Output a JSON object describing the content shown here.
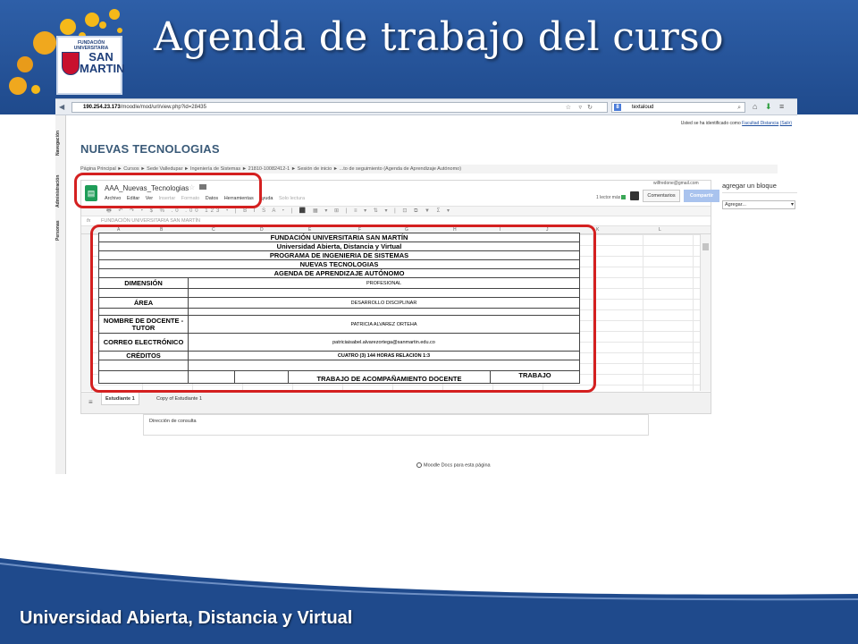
{
  "slide": {
    "title": "Agenda de trabajo del curso",
    "footer": "Universidad Abierta, Distancia y Virtual",
    "logo": {
      "top": "FUNDACIÓN UNIVERSITARIA",
      "name_1": "SAN",
      "name_2": "MARTIN"
    }
  },
  "browser": {
    "url_host": "190.254.23.173",
    "url_path": "/moodle/mod/url/view.php?id=28435",
    "search_value": "textaloud",
    "search_engine_icon": "google-icon"
  },
  "moodle": {
    "sidebar": [
      "Navegación",
      "Administración",
      "Personas"
    ],
    "login_prefix": "Usted se ha identificado como",
    "login_user": "Facultad Distancia",
    "login_logout": "(Salir)",
    "course_title": "NUEVAS TECNOLOGIAS",
    "breadcrumb": "Página Principal ► Cursos ► Sede Valledupar ► Ingeniería de Sistemas ► 21810-10082412-1 ► Sesión de inicio ► ...to de seguimiento (Agenda de Aprendizaje Autónomo)",
    "consulta": "Dirección de consulta",
    "moodle_docs": "Moodle Docs para esta página",
    "block_title": "agregar un bloque",
    "block_select": "Agregar..."
  },
  "sheet": {
    "doc_name": "AAA_Nuevas_Tecnologias",
    "menu": [
      "Archivo",
      "Editar",
      "Ver",
      "Insertar",
      "Formato",
      "Datos",
      "Herramientas",
      "Ayuda",
      "Solo lectura"
    ],
    "menu_disabled": [
      false,
      false,
      false,
      true,
      true,
      false,
      false,
      false,
      true
    ],
    "email": "wilfredone@gmail.com",
    "readers": "1 lector más",
    "comments_button": "Comentarios",
    "share_button": "Compartir",
    "fx_label": "fx",
    "fx_value": "FUNDACIÓN UNIVERSITARIA SAN MARTÍN",
    "columns": [
      "A",
      "B",
      "C",
      "D",
      "E",
      "F",
      "G",
      "H",
      "I",
      "J",
      "K",
      "L"
    ],
    "tabs": [
      "Estudiante 1",
      "Copy of Estudiante 1"
    ]
  },
  "agenda": {
    "headers": [
      "FUNDACIÓN UNIVERSITARIA SAN MARTÍN",
      "Universidad Abierta, Distancia y Virtual",
      "PROGRAMA DE INGENIERIA DE SISTEMAS",
      "NUEVAS TECNOLOGIAS",
      "AGENDA DE APRENDIZAJE AUTÓNOMO"
    ],
    "rows": [
      {
        "label": "DIMENSIÓN",
        "value": "PROFESIONAL"
      },
      {
        "label": "ÁREA",
        "value": "DESARROLLO DISCIPLINAR"
      },
      {
        "label": "NOMBRE DE DOCENTE - TUTOR",
        "value": "PATRICIA ALVAREZ ORTEHA"
      },
      {
        "label": "CORREO ELECTRÓNICO",
        "value": "patriciaisabel.alvarezortega@sanmartin.edu.co"
      },
      {
        "label": "CRÉDITOS",
        "value": "CUATRO (3) 144 HORAS RELACION 1:3"
      }
    ],
    "partial_1": "TRABAJO DE ACOMPAÑAMIENTO DOCENTE",
    "partial_2": "TRABAJO"
  },
  "colors": {
    "header_blue": "#1f4a8c",
    "highlight_red": "#d42020",
    "sheets_green": "#1e9d58"
  }
}
